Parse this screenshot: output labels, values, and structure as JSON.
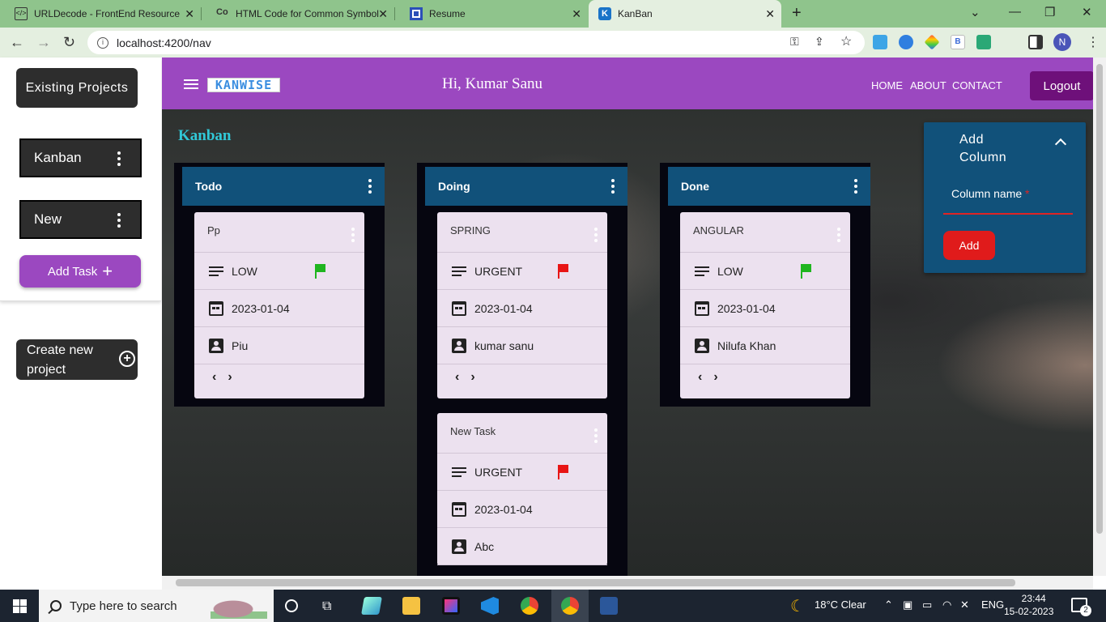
{
  "browser": {
    "tabs": [
      {
        "title": "URLDecode - FrontEnd Resource",
        "active": false
      },
      {
        "title": "HTML Code for Common Symbol",
        "active": false
      },
      {
        "title": "Resume",
        "active": false
      },
      {
        "title": "KanBan",
        "active": true
      }
    ],
    "url": "localhost:4200/nav",
    "profile_initial": "N"
  },
  "sidebar": {
    "existing_projects_label": "Existing Projects",
    "projects": [
      {
        "name": "Kanban"
      },
      {
        "name": "New"
      }
    ],
    "add_task_label": "Add Task",
    "create_project_line1": "Create new",
    "create_project_line2": "project"
  },
  "header": {
    "logo_text": "KANWISE",
    "greeting": "Hi, Kumar Sanu",
    "nav": [
      "HOME",
      "ABOUT",
      "CONTACT"
    ],
    "logout_label": "Logout"
  },
  "board": {
    "title": "Kanban",
    "columns": [
      {
        "name": "Todo",
        "cards": [
          {
            "title": "Pp",
            "priority": "LOW",
            "priority_color": "#1fb51f",
            "date": "2023-01-04",
            "assignee": "Piu"
          }
        ]
      },
      {
        "name": "Doing",
        "cards": [
          {
            "title": "SPRING",
            "priority": "URGENT",
            "priority_color": "#e81515",
            "date": "2023-01-04",
            "assignee": "kumar sanu"
          },
          {
            "title": "New Task",
            "priority": "URGENT",
            "priority_color": "#e81515",
            "date": "2023-01-04",
            "assignee": "Abc"
          }
        ]
      },
      {
        "name": "Done",
        "cards": [
          {
            "title": "ANGULAR",
            "priority": "LOW",
            "priority_color": "#1fb51f",
            "date": "2023-01-04",
            "assignee": "Nilufa Khan"
          }
        ]
      }
    ]
  },
  "add_column": {
    "title_line1": "Add",
    "title_line2": "Column",
    "field_label": "Column name",
    "required_mark": "*",
    "button_label": "Add"
  },
  "taskbar": {
    "search_placeholder": "Type here to search",
    "weather": "18°C  Clear",
    "language": "ENG",
    "time": "23:44",
    "date": "15-02-2023",
    "notification_count": "2"
  },
  "colors": {
    "header_purple": "#9b48c0",
    "column_header_blue": "#11517a",
    "card_bg": "#ece1ef",
    "logout_bg": "#6e107a",
    "add_button_red": "#e01b1b"
  }
}
